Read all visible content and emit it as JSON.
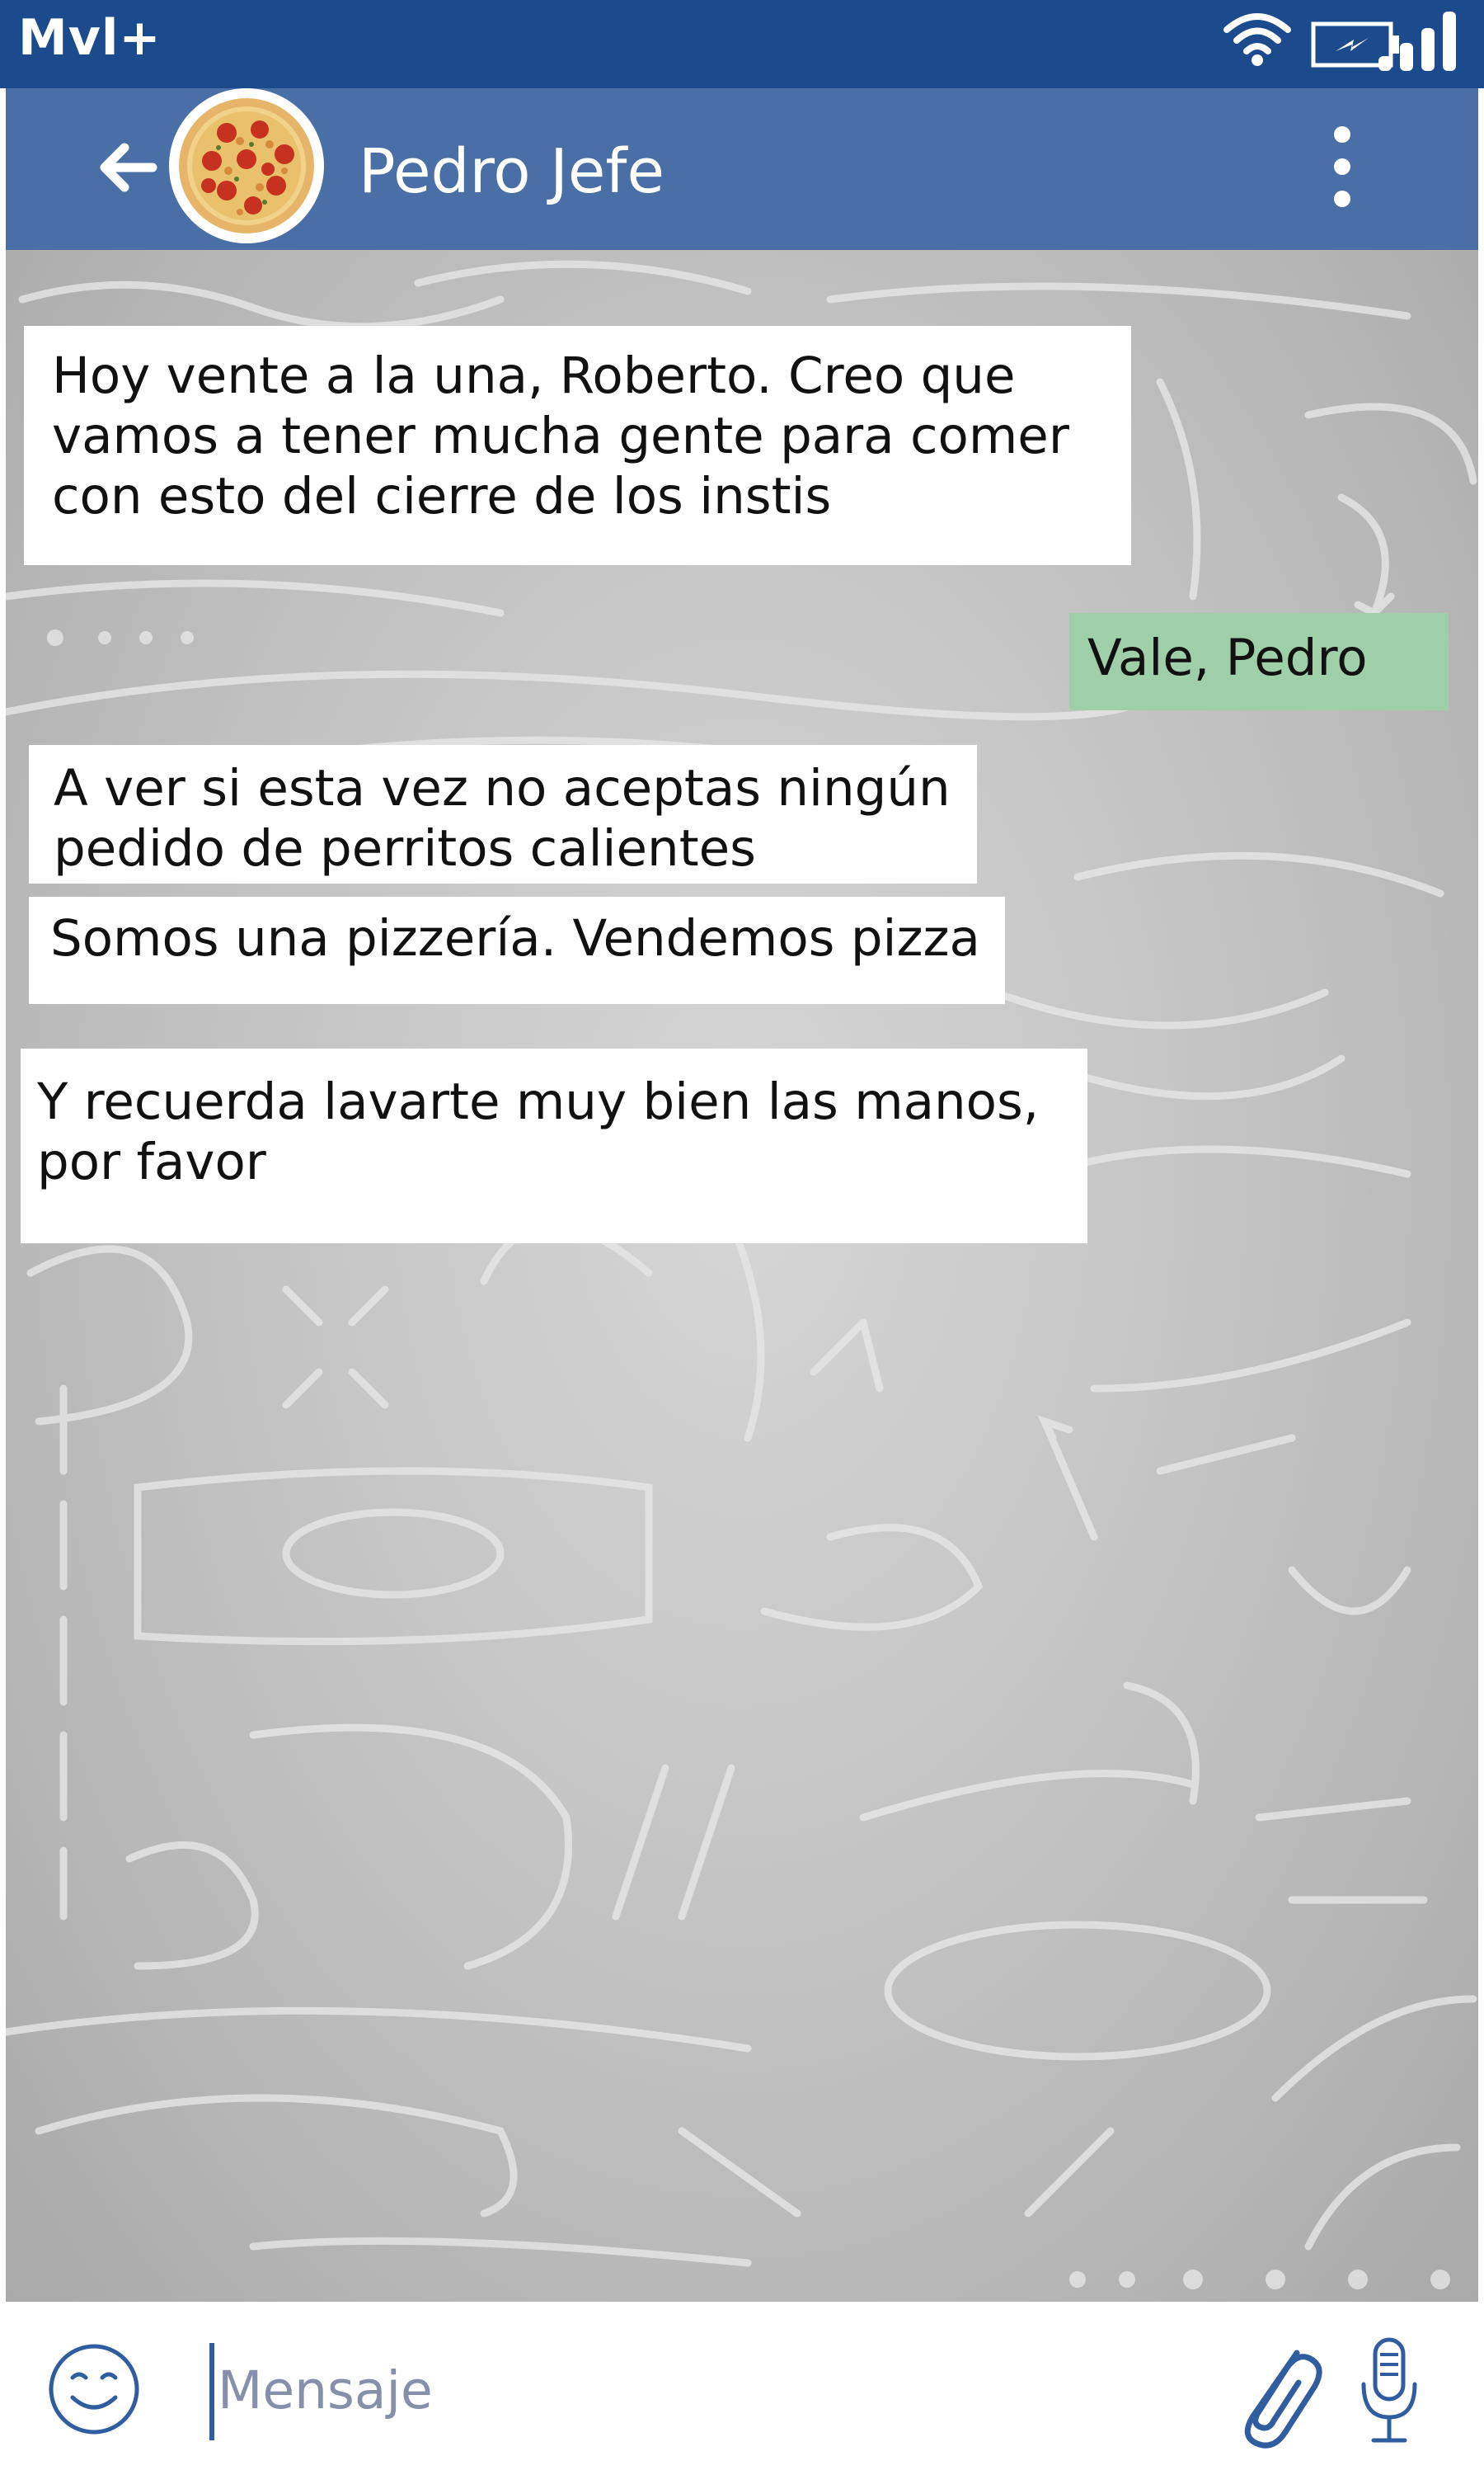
{
  "status_bar": {
    "carrier": "Mvl+",
    "icons": [
      "wifi-icon",
      "battery-charging-icon",
      "signal-icon"
    ]
  },
  "header": {
    "contact_name": "Pedro Jefe",
    "avatar": "pizza-avatar",
    "back_icon": "back-arrow-icon",
    "menu_icon": "more-vert-icon",
    "color": "#4a6ea6"
  },
  "messages": [
    {
      "direction": "in",
      "text": "Hoy vente a la una, Roberto. Creo que\nvamos a tener mucha gente para comer\ncon esto del cierre de los instis"
    },
    {
      "direction": "out",
      "text": "Vale, Pedro"
    },
    {
      "direction": "in",
      "text": "A ver si esta vez no aceptas ningún\npedido de perritos calientes"
    },
    {
      "direction": "in",
      "text": "Somos una pizzería. Vendemos pizza"
    },
    {
      "direction": "in",
      "text": "Y recuerda lavarte muy bien las manos,\npor favor"
    }
  ],
  "composer": {
    "placeholder": "Mensaje",
    "value": "",
    "emoji_icon": "emoji-icon",
    "attach_icon": "attach-icon",
    "mic_icon": "mic-icon"
  },
  "colors": {
    "status_bar": "#1b4b8c",
    "outgoing_bubble": "#9ecfa8",
    "incoming_bubble": "#ffffff"
  }
}
